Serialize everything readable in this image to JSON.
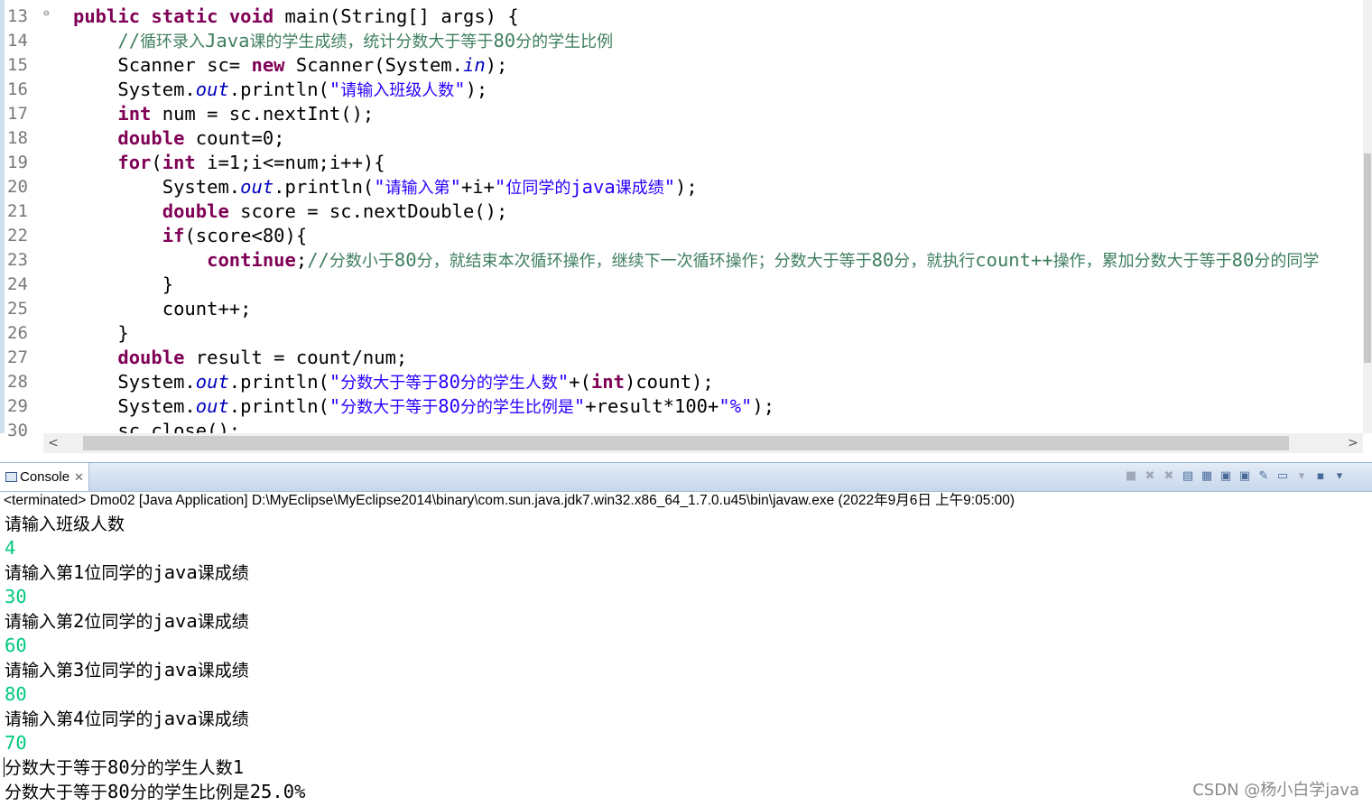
{
  "editor": {
    "line_numbers": [
      "13",
      "14",
      "15",
      "16",
      "17",
      "18",
      "19",
      "20",
      "21",
      "22",
      "23",
      "24",
      "25",
      "26",
      "27",
      "28",
      "29",
      "30"
    ]
  },
  "console": {
    "tab_label": "Console",
    "close_glyph": "✕",
    "status": "<terminated> Dmo02 [Java Application] D:\\MyEclipse\\MyEclipse2014\\binary\\com.sun.java.jdk7.win32.x86_64_1.7.0.u45\\bin\\javaw.exe (2022年9月6日 上午9:05:00)",
    "output": [
      {
        "type": "prompt",
        "text": "请输入班级人数"
      },
      {
        "type": "input",
        "text": "4"
      },
      {
        "type": "prompt",
        "text": "请输入第1位同学的java课成绩"
      },
      {
        "type": "input",
        "text": "30"
      },
      {
        "type": "prompt",
        "text": "请输入第2位同学的java课成绩"
      },
      {
        "type": "input",
        "text": "60"
      },
      {
        "type": "prompt",
        "text": "请输入第3位同学的java课成绩"
      },
      {
        "type": "input",
        "text": "80"
      },
      {
        "type": "prompt",
        "text": "请输入第4位同学的java课成绩"
      },
      {
        "type": "input",
        "text": "70"
      },
      {
        "type": "prompt",
        "text": "分数大于等于80分的学生人数1"
      },
      {
        "type": "prompt",
        "text": "分数大于等于80分的学生比例是25.0%"
      }
    ]
  },
  "watermark": "CSDN @杨小白学java",
  "colors": {
    "keyword": "#7f0055",
    "field": "#0000c0",
    "string": "#2a00ff",
    "comment": "#3f7f5f",
    "input_text": "#00c87d"
  }
}
